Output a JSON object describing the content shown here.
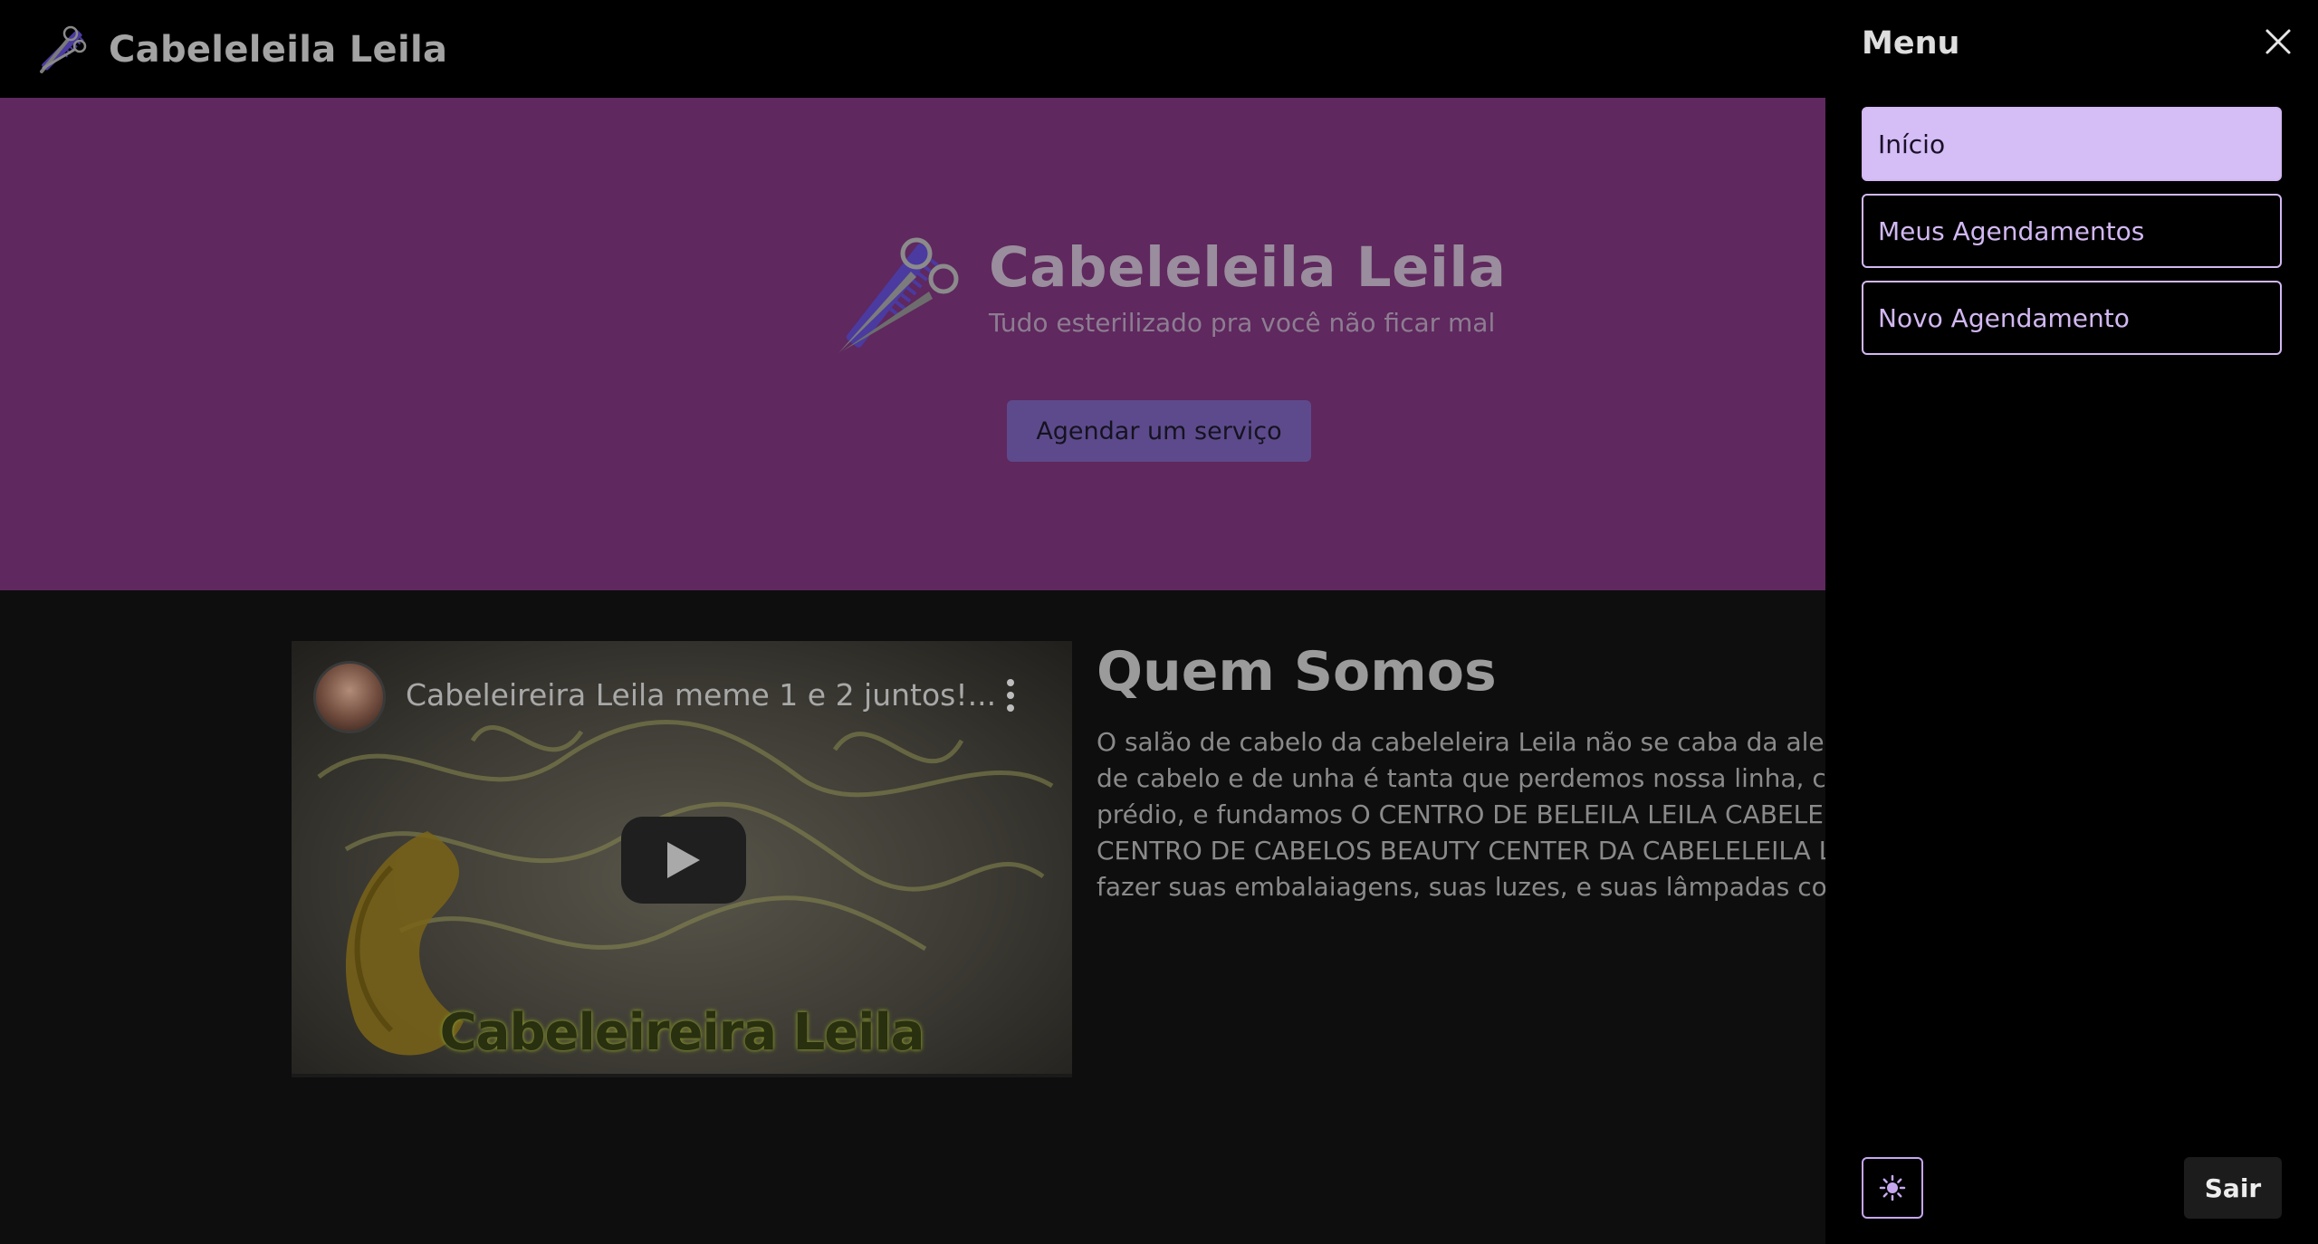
{
  "header": {
    "brand_title": "Cabeleleila Leila",
    "logo_icon": "scissors-comb-icon"
  },
  "hero": {
    "title": "Cabeleleila Leila",
    "subtitle": "Tudo esterilizado pra você não ficar mal",
    "cta_label": "Agendar um serviço",
    "logo_icon": "scissors-comb-icon"
  },
  "video": {
    "title": "Cabeleireira Leila meme 1 e 2 juntos!...",
    "caption": "Cabeleireira Leila",
    "play_icon": "play-icon",
    "more_icon": "more-vertical-icon"
  },
  "about": {
    "title": "Quem Somos",
    "lines": [
      "O salão de cabelo da cabeleleira Leila não se caba da alegria",
      "de cabelo e de unha é tanta que perdemos nossa linha, con",
      "prédio, e fundamos O CENTRO DE BELEILA LEILA CABELEL",
      "CENTRO DE CABELOS BEAUTY CENTER DA CABELELEILA L",
      "fazer suas embalaiagens, suas luzes, e suas lâmpadas conos"
    ]
  },
  "menu": {
    "title": "Menu",
    "close_icon": "close-icon",
    "items": [
      {
        "label": "Início",
        "active": true
      },
      {
        "label": "Meus Agendamentos",
        "active": false
      },
      {
        "label": "Novo Agendamento",
        "active": false
      }
    ],
    "theme_icon": "sun-icon",
    "logout_label": "Sair"
  },
  "colors": {
    "hero_bg": "#5f285e",
    "menu_accent": "#d5bdf6",
    "cta_bg": "#5d4a8c",
    "page_bg": "#0e0e0e"
  }
}
